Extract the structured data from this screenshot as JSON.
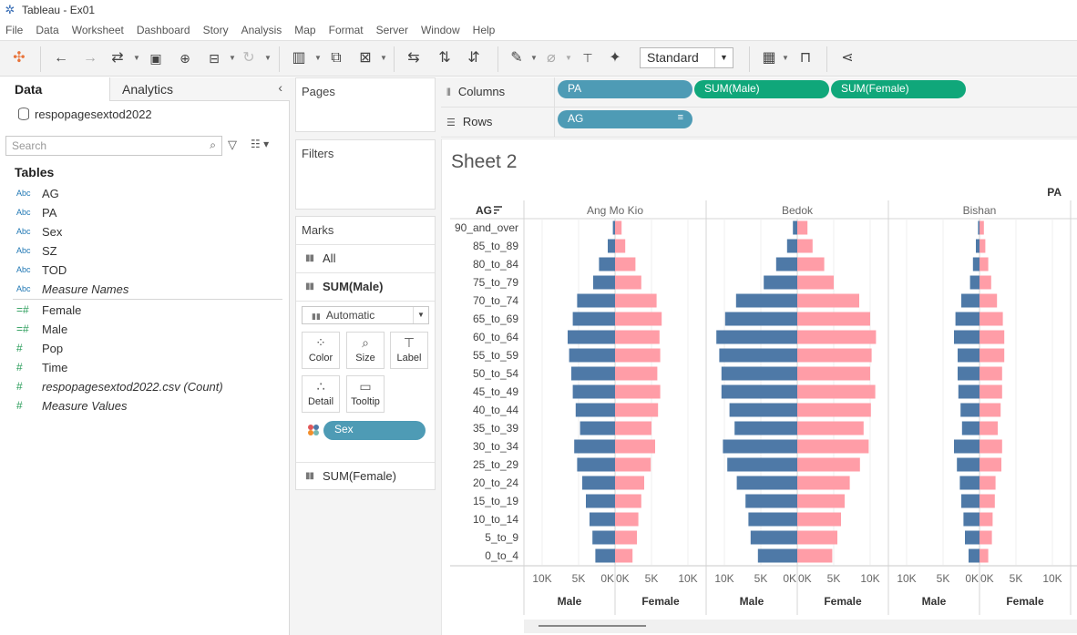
{
  "window": {
    "title": "Tableau - Ex01"
  },
  "menu": [
    "File",
    "Data",
    "Worksheet",
    "Dashboard",
    "Story",
    "Analysis",
    "Map",
    "Format",
    "Server",
    "Window",
    "Help"
  ],
  "toolbar": {
    "fit_select": "Standard"
  },
  "left_pane": {
    "tab_data": "Data",
    "tab_analytics": "Analytics",
    "datasource": "respopagesextod2022",
    "search_placeholder": "Search",
    "tables_heading": "Tables",
    "dimensions": [
      {
        "type": "Abc",
        "name": "AG",
        "italic": false
      },
      {
        "type": "Abc",
        "name": "PA",
        "italic": false
      },
      {
        "type": "Abc",
        "name": "Sex",
        "italic": false
      },
      {
        "type": "Abc",
        "name": "SZ",
        "italic": false
      },
      {
        "type": "Abc",
        "name": "TOD",
        "italic": false
      },
      {
        "type": "Abc",
        "name": "Measure Names",
        "italic": true
      }
    ],
    "measures": [
      {
        "type": "=#",
        "name": "Female",
        "italic": false
      },
      {
        "type": "=#",
        "name": "Male",
        "italic": false
      },
      {
        "type": "#",
        "name": "Pop",
        "italic": false
      },
      {
        "type": "#",
        "name": "Time",
        "italic": false
      },
      {
        "type": "#",
        "name": "respopagesextod2022.csv (Count)",
        "italic": true
      },
      {
        "type": "#",
        "name": "Measure Values",
        "italic": true
      }
    ]
  },
  "cards": {
    "pages": "Pages",
    "filters": "Filters",
    "marks": "Marks",
    "marks_all": "All",
    "marks_male": "SUM(Male)",
    "mark_type": "Automatic",
    "buttons": [
      "Color",
      "Size",
      "Label",
      "Detail",
      "Tooltip"
    ],
    "sex_pill": "Sex",
    "marks_female": "SUM(Female)"
  },
  "shelves": {
    "columns_label": "Columns",
    "rows_label": "Rows",
    "columns_pills": [
      "PA",
      "SUM(Male)",
      "SUM(Female)"
    ],
    "rows_pills": [
      "AG"
    ]
  },
  "sheet": {
    "title": "Sheet 2",
    "pa_header": "PA",
    "ag_header": "AG"
  },
  "colors": {
    "male": "#4e79a7",
    "female": "#ff9da7",
    "pill_blue": "#4e9bb5",
    "pill_green": "#10a77a"
  },
  "chart_data": {
    "type": "bar",
    "orientation": "horizontal-butterfly",
    "categories": [
      "90_and_over",
      "85_to_89",
      "80_to_84",
      "75_to_79",
      "70_to_74",
      "65_to_69",
      "60_to_64",
      "55_to_59",
      "50_to_54",
      "45_to_49",
      "40_to_44",
      "35_to_39",
      "30_to_34",
      "25_to_29",
      "20_to_24",
      "15_to_19",
      "10_to_14",
      "5_to_9",
      "0_to_4"
    ],
    "axis_ticks": [
      "10K",
      "5K",
      "0K"
    ],
    "axis_ticks_right": [
      "0K",
      "5K",
      "10K"
    ],
    "axis_titles": [
      "Male",
      "Female"
    ],
    "xlim": [
      0,
      12000
    ],
    "panels": [
      {
        "name": "Ang Mo Kio",
        "series": [
          {
            "name": "Male",
            "values": [
              300,
              1000,
              2200,
              3000,
              5200,
              5800,
              6500,
              6300,
              6000,
              5800,
              5400,
              4800,
              5600,
              5200,
              4500,
              4000,
              3500,
              3100,
              2700
            ]
          },
          {
            "name": "Female",
            "values": [
              900,
              1400,
              2800,
              3600,
              5700,
              6400,
              6100,
              6200,
              5800,
              6200,
              5900,
              5000,
              5500,
              4900,
              4000,
              3600,
              3200,
              3000,
              2400
            ]
          }
        ]
      },
      {
        "name": "Bedok",
        "series": [
          {
            "name": "Male",
            "values": [
              600,
              1400,
              2900,
              4600,
              8400,
              9900,
              11100,
              10700,
              10400,
              10400,
              9300,
              8600,
              10200,
              9600,
              8300,
              7100,
              6700,
              6400,
              5400
            ]
          },
          {
            "name": "Female",
            "values": [
              1400,
              2100,
              3700,
              5000,
              8500,
              10000,
              10800,
              10200,
              10000,
              10700,
              10100,
              9100,
              9800,
              8600,
              7200,
              6500,
              6000,
              5500,
              4800
            ]
          }
        ]
      },
      {
        "name": "Bishan",
        "series": [
          {
            "name": "Male",
            "values": [
              200,
              500,
              900,
              1300,
              2500,
              3300,
              3500,
              3000,
              3000,
              2900,
              2600,
              2400,
              3500,
              3100,
              2700,
              2500,
              2200,
              2000,
              1500
            ]
          },
          {
            "name": "Female",
            "values": [
              600,
              800,
              1200,
              1600,
              2400,
              3200,
              3400,
              3400,
              3100,
              3100,
              2900,
              2500,
              3100,
              3000,
              2200,
              2100,
              1800,
              1700,
              1200
            ]
          }
        ]
      }
    ]
  }
}
